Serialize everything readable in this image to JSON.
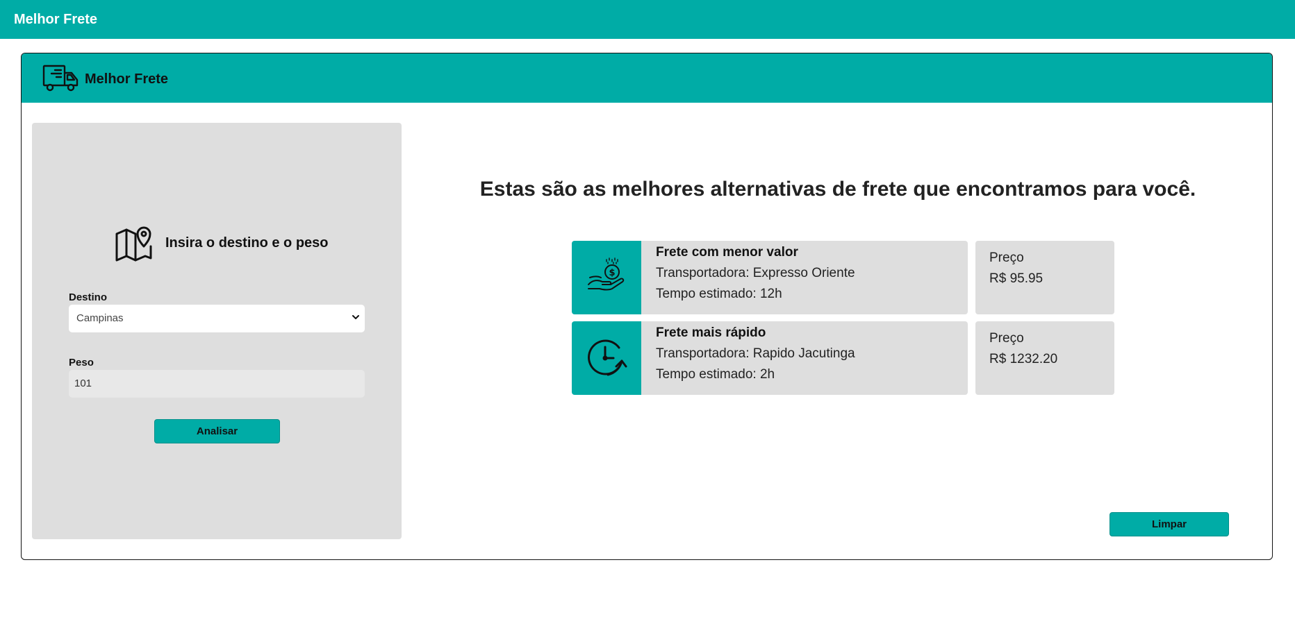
{
  "navbar": {
    "brand": "Melhor Frete"
  },
  "card": {
    "title": "Melhor Frete"
  },
  "form": {
    "heading": "Insira o destino e o peso",
    "destino_label": "Destino",
    "destino_value": "Campinas",
    "peso_label": "Peso",
    "peso_value": "101",
    "submit_label": "Analisar"
  },
  "results": {
    "heading": "Estas são as melhores alternativas de frete que encontramos para você.",
    "options": [
      {
        "title": "Frete com menor valor",
        "carrier": "Transportadora: Expresso Oriente",
        "time": "Tempo estimado: 12h",
        "price_label": "Preço",
        "price": "R$ 95.95",
        "icon": "money-hand-icon"
      },
      {
        "title": "Frete mais rápido",
        "carrier": "Transportadora: Rapido Jacutinga",
        "time": "Tempo estimado: 2h",
        "price_label": "Preço",
        "price": "R$ 1232.20",
        "icon": "clock-icon"
      }
    ],
    "clear_label": "Limpar"
  },
  "colors": {
    "accent": "#00aca6",
    "panel": "#dedede"
  }
}
